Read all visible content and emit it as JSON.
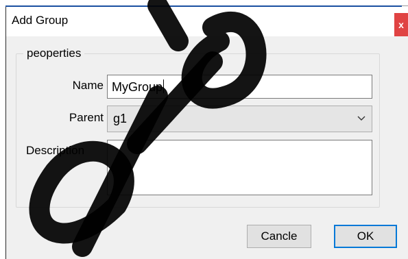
{
  "window": {
    "title": "Add Group",
    "close_label": "x"
  },
  "group": {
    "legend": "peoperties"
  },
  "form": {
    "name_label": "Name",
    "name_value": "MyGroup",
    "parent_label": "Parent",
    "parent_value": "g1",
    "description_label": "Description",
    "description_value": ""
  },
  "buttons": {
    "cancel_label": "Cancle",
    "ok_label": "OK"
  },
  "colors": {
    "close_button": "#e04343",
    "ok_border": "#0078d7",
    "dialog_bg": "#f0f0f0",
    "watermark": "#000000"
  },
  "icons": {
    "close": "close-icon",
    "dropdown": "chevron-down-icon"
  }
}
